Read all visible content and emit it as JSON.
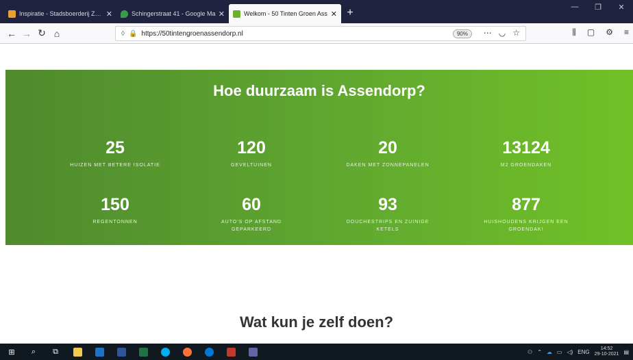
{
  "browser": {
    "tabs": [
      {
        "title": "Inspiratie - Stadsboerderij Zwol",
        "favcolor": "#e8a035"
      },
      {
        "title": "Schingerstraat 41 - Google Ma",
        "favcolor": "#3a9a4a"
      },
      {
        "title": "Welkom - 50 Tinten Groen Ass",
        "favcolor": "#6ab22e"
      }
    ],
    "new_tab": "+",
    "url": "https://50tintengroenassendorp.nl",
    "zoom": "90%"
  },
  "page": {
    "section_title": "Hoe duurzaam is Assendorp?",
    "stats": [
      {
        "value": "25",
        "label": "HUIZEN MET BETERE ISOLATIE"
      },
      {
        "value": "120",
        "label": "GEVELTUINEN"
      },
      {
        "value": "20",
        "label": "DAKEN MET ZONNEPANELEN"
      },
      {
        "value": "13124",
        "label": "M2 GROENDAKEN"
      },
      {
        "value": "150",
        "label": "REGENTONNEN"
      },
      {
        "value": "60",
        "label": "AUTO'S OP AFSTAND GEPARKEERD"
      },
      {
        "value": "93",
        "label": "DOUCHESTRIPS EN ZUINIGE KETELS"
      },
      {
        "value": "877",
        "label": "HUISHOUDENS KRIJGEN EEN GROENDAK!"
      }
    ],
    "next_heading": "Wat kun je zelf doen?"
  },
  "taskbar": {
    "lang": "ENG",
    "time": "14:52",
    "date": "29-10-2021"
  }
}
